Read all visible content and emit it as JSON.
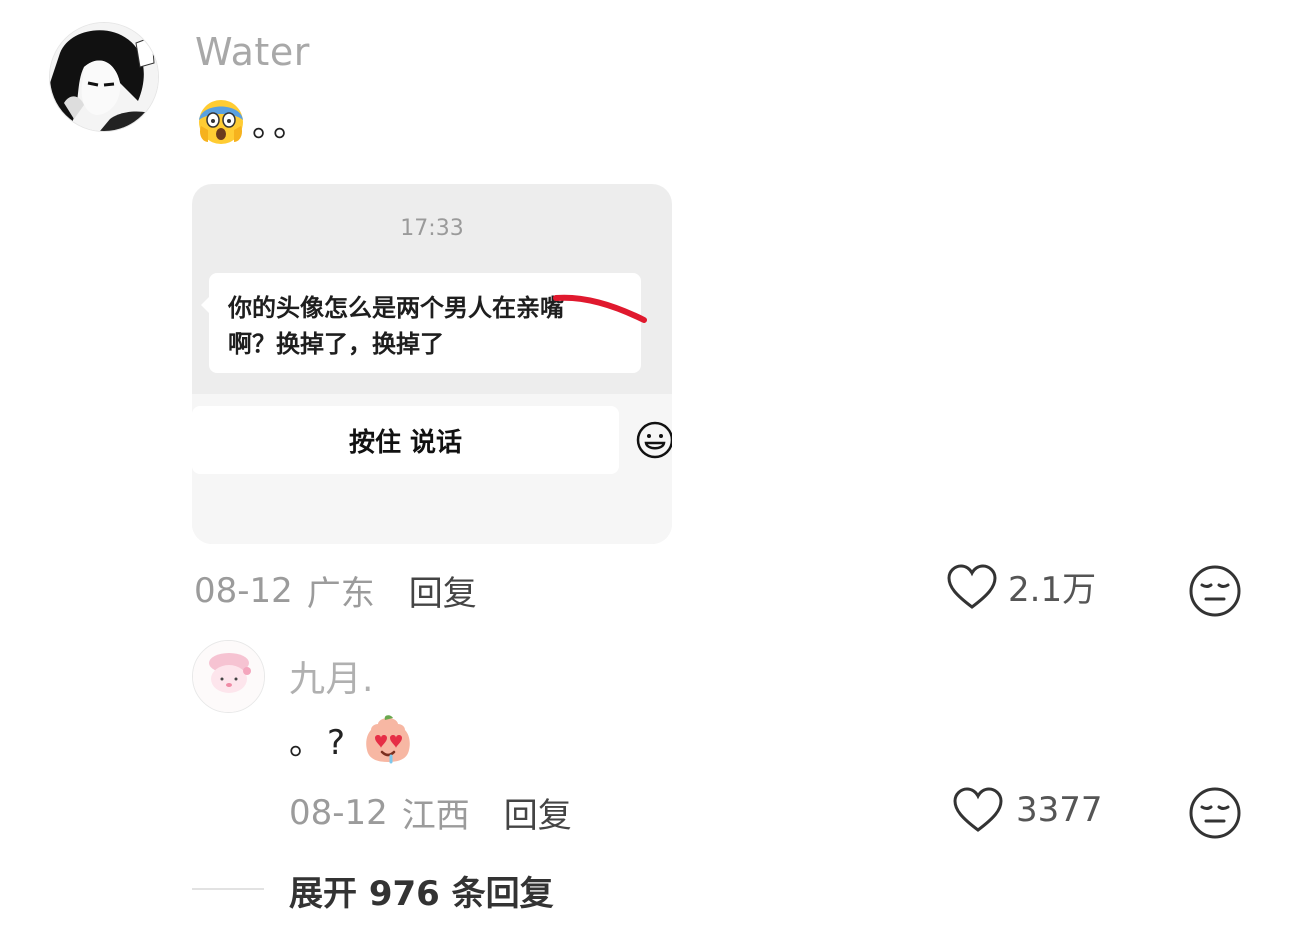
{
  "comment": {
    "username": "Water",
    "text": "。。",
    "screenshot": {
      "time": "17:33",
      "message_line1": "你的头像怎么是两个男人在亲嘴",
      "message_line2": "啊？换掉了，换掉了",
      "hold_to_talk": "按住 说话"
    },
    "date": "08-12",
    "location": "广东",
    "reply_label": "回复",
    "likes": "2.1万"
  },
  "reply": {
    "username": "九月.",
    "text": "。?",
    "date": "08-12",
    "location": "江西",
    "reply_label": "回复",
    "likes": "3377"
  },
  "expand": {
    "label": "展开 976 条回复"
  },
  "colors": {
    "muted": "#9b9b9b",
    "card_bg": "#ededed",
    "strike": "#e0192e"
  }
}
